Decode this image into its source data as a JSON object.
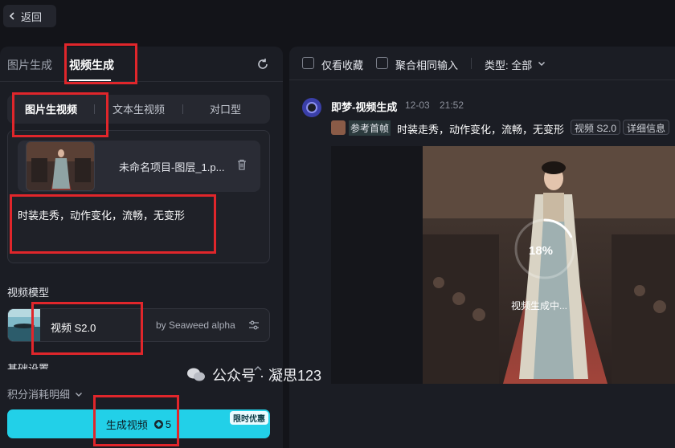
{
  "topbar": {
    "back_label": "返回"
  },
  "left": {
    "tabs": [
      {
        "label": "图片生成",
        "active": false
      },
      {
        "label": "视频生成",
        "active": true
      }
    ],
    "sub_tabs": [
      {
        "label": "图片生视频",
        "active": true
      },
      {
        "label": "文本生视频",
        "active": false
      },
      {
        "label": "对口型",
        "active": false
      }
    ],
    "upload": {
      "file_name": "未命名项目-图层_1.p..."
    },
    "prompt": "时装走秀，动作变化，流畅，无变形",
    "model_section_title": "视频模型",
    "model": {
      "name": "视频 S2.0",
      "by": "by Seaweed alpha"
    },
    "basic_settings_title": "基础设置",
    "points_detail_label": "积分消耗明细",
    "generate": {
      "label": "生成视频",
      "cost": "5",
      "badge": "限时优惠"
    }
  },
  "right": {
    "filters": {
      "favorites_label": "仅看收藏",
      "aggregate_label": "聚合相同输入",
      "type_label": "类型: 全部"
    },
    "entry": {
      "title": "即梦-视频生成",
      "date": "12-03",
      "time": "21:52",
      "ref_label": "参考首帧",
      "prompt": "时装走秀，动作变化，流畅，无变形",
      "tags": [
        "视频 S2.0",
        "详细信息"
      ],
      "progress": 0.18,
      "progress_label": "18%",
      "status": "视频生成中..."
    }
  },
  "watermark": "公众号 · 凝思123",
  "colors": {
    "accent": "#22d0e8",
    "annotation": "#e0262b",
    "panel": "#1b1d24"
  },
  "icons": [
    "chevron-left-icon",
    "refresh-icon",
    "trash-icon",
    "tune-icon",
    "chevron-up-icon",
    "chevron-down-icon",
    "wechat-icon"
  ]
}
